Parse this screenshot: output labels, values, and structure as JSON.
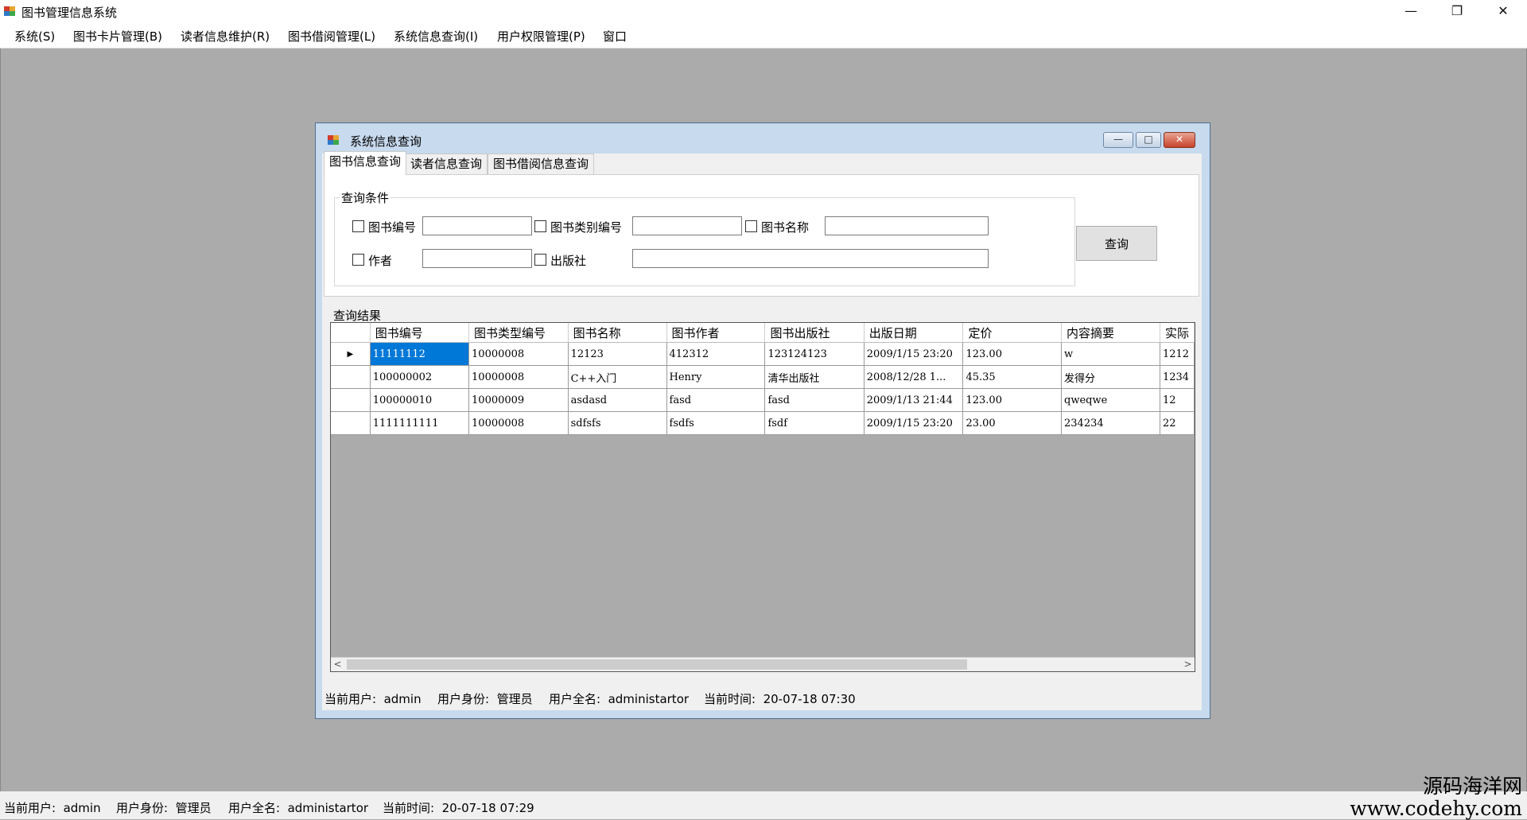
{
  "app": {
    "title": "图书管理信息系统",
    "window_controls": {
      "minimize": "—",
      "maximize": "❐",
      "close": "✕"
    }
  },
  "menu": [
    "系统(S)",
    "图书卡片管理(B)",
    "读者信息维护(R)",
    "图书借阅管理(L)",
    "系统信息查询(I)",
    "用户权限管理(P)",
    "窗口"
  ],
  "child_window": {
    "title": "系统信息查询",
    "controls": {
      "minimize": "—",
      "maximize": "□",
      "close": "✕"
    },
    "tabs": [
      "图书信息查询",
      "读者信息查询",
      "图书借阅信息查询"
    ],
    "active_tab": 0,
    "query": {
      "legend": "查询条件",
      "fields": {
        "book_no": {
          "label": "图书编号",
          "value": "",
          "checked": false
        },
        "type_no": {
          "label": "图书类别编号",
          "value": "",
          "checked": false
        },
        "name": {
          "label": "图书名称",
          "value": "",
          "checked": false
        },
        "author": {
          "label": "作者",
          "value": "",
          "checked": false
        },
        "publisher": {
          "label": "出版社",
          "value": "",
          "checked": false
        }
      },
      "button": "查询"
    },
    "results": {
      "label": "查询结果",
      "columns": [
        "图书编号",
        "图书类型编号",
        "图书名称",
        "图书作者",
        "图书出版社",
        "出版日期",
        "定价",
        "内容摘要",
        "实际"
      ],
      "rows": [
        [
          "11111112",
          "10000008",
          "12123",
          "412312",
          "123124123",
          "2009/1/15 23:20",
          "123.00",
          "w",
          "1212"
        ],
        [
          "100000002",
          "10000008",
          "C++入门",
          "Henry",
          "清华出版社",
          "2008/12/28 1...",
          "45.35",
          "发得分",
          "1234"
        ],
        [
          "100000010",
          "10000009",
          "asdasd",
          "fasd",
          "fasd",
          "2009/1/13 21:44",
          "123.00",
          "qweqwe",
          "12"
        ],
        [
          "1111111111",
          "10000008",
          "sdfsfs",
          "fsdfs",
          "fsdf",
          "2009/1/15 23:20",
          "23.00",
          "234234",
          "22"
        ]
      ],
      "current_row_marker": "▶",
      "scroll_left": "<",
      "scroll_right": ">"
    },
    "status": {
      "user": "当前用户:  admin",
      "role": "用户身份:  管理员",
      "fullname": "用户全名:  administartor",
      "time": "当前时间:  20-07-18 07:30"
    }
  },
  "status": {
    "user": "当前用户:  admin",
    "role": "用户身份:  管理员",
    "fullname": "用户全名:  administartor",
    "time": "当前时间:  20-07-18 07:29"
  },
  "watermark": {
    "line1": "源码海洋网",
    "line2": "www.codehy.com"
  }
}
